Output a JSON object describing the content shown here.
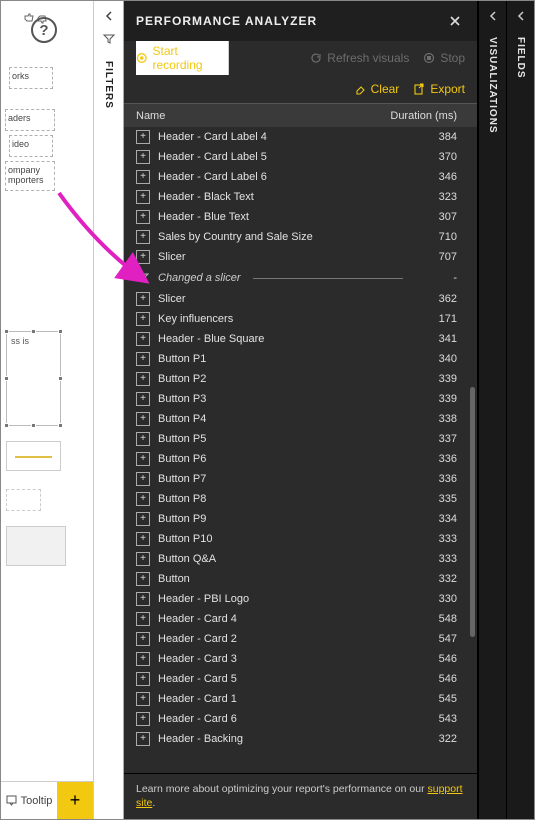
{
  "header": {
    "title": "PERFORMANCE ANALYZER"
  },
  "actions": {
    "start_recording": "Start recording",
    "refresh_visuals": "Refresh visuals",
    "stop": "Stop",
    "clear": "Clear",
    "export": "Export"
  },
  "table": {
    "col_name": "Name",
    "col_duration": "Duration (ms)",
    "rows": [
      {
        "type": "item",
        "name": "Header - Card Label 4",
        "duration": "384"
      },
      {
        "type": "item",
        "name": "Header - Card Label 5",
        "duration": "370"
      },
      {
        "type": "item",
        "name": "Header - Card Label 6",
        "duration": "346"
      },
      {
        "type": "item",
        "name": "Header - Black Text",
        "duration": "323"
      },
      {
        "type": "item",
        "name": "Header - Blue Text",
        "duration": "307"
      },
      {
        "type": "item",
        "name": "Sales by Country and Sale Size",
        "duration": "710"
      },
      {
        "type": "item",
        "name": "Slicer",
        "duration": "707"
      },
      {
        "type": "event",
        "name": "Changed a slicer",
        "duration": "-"
      },
      {
        "type": "item",
        "name": "Slicer",
        "duration": "362"
      },
      {
        "type": "item",
        "name": "Key influencers",
        "duration": "171"
      },
      {
        "type": "item",
        "name": "Header - Blue Square",
        "duration": "341"
      },
      {
        "type": "item",
        "name": "Button P1",
        "duration": "340"
      },
      {
        "type": "item",
        "name": "Button P2",
        "duration": "339"
      },
      {
        "type": "item",
        "name": "Button P3",
        "duration": "339"
      },
      {
        "type": "item",
        "name": "Button P4",
        "duration": "338"
      },
      {
        "type": "item",
        "name": "Button P5",
        "duration": "337"
      },
      {
        "type": "item",
        "name": "Button P6",
        "duration": "336"
      },
      {
        "type": "item",
        "name": "Button P7",
        "duration": "336"
      },
      {
        "type": "item",
        "name": "Button P8",
        "duration": "335"
      },
      {
        "type": "item",
        "name": "Button P9",
        "duration": "334"
      },
      {
        "type": "item",
        "name": "Button P10",
        "duration": "333"
      },
      {
        "type": "item",
        "name": "Button Q&A",
        "duration": "333"
      },
      {
        "type": "item",
        "name": "Button",
        "duration": "332"
      },
      {
        "type": "item",
        "name": "Header - PBI Logo",
        "duration": "330"
      },
      {
        "type": "item",
        "name": "Header - Card 4",
        "duration": "548"
      },
      {
        "type": "item",
        "name": "Header - Card 2",
        "duration": "547"
      },
      {
        "type": "item",
        "name": "Header - Card 3",
        "duration": "546"
      },
      {
        "type": "item",
        "name": "Header - Card 5",
        "duration": "546"
      },
      {
        "type": "item",
        "name": "Header - Card 1",
        "duration": "545"
      },
      {
        "type": "item",
        "name": "Header - Card 6",
        "duration": "543"
      },
      {
        "type": "item",
        "name": "Header - Backing",
        "duration": "322"
      }
    ]
  },
  "footer": {
    "text_a": "Learn more about optimizing your report's performance on our ",
    "link": "support site",
    "text_b": "."
  },
  "side_panes": {
    "filters": "FILTERS",
    "visualizations": "VISUALIZATIONS",
    "fields": "FIELDS"
  },
  "tabs": {
    "tooltip": "Tooltip",
    "add": "+"
  },
  "canvas_labels": {
    "a": "orks",
    "b": "aders",
    "c": "ideo",
    "d": "ompany",
    "e": "mporters",
    "f": "ss is"
  },
  "colors": {
    "accent": "#f2c811"
  }
}
